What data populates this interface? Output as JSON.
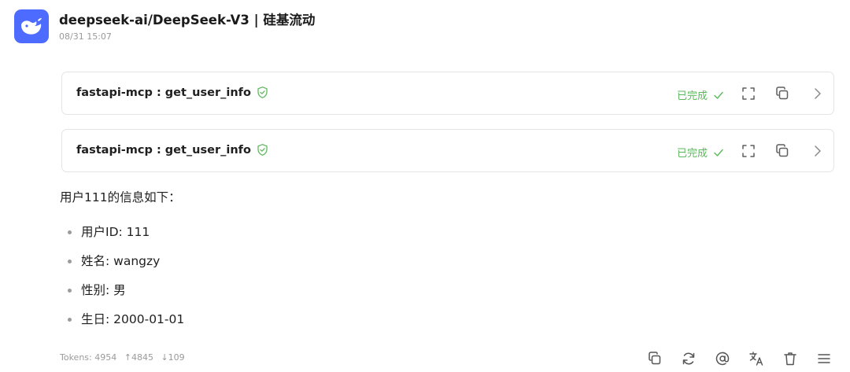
{
  "header": {
    "title": "deepseek-ai/DeepSeek-V3 | 硅基流动",
    "timestamp": "08/31 15:07"
  },
  "tool_calls": [
    {
      "name": "fastapi-mcp : get_user_info",
      "status": "已完成"
    },
    {
      "name": "fastapi-mcp : get_user_info",
      "status": "已完成"
    }
  ],
  "message": {
    "intro": "用户111的信息如下：",
    "items": [
      "用户ID: 111",
      "姓名: wangzy",
      "性别: 男",
      "生日: 2000-01-01"
    ]
  },
  "footer": {
    "tokens_label": "Tokens: 4954",
    "tokens_up": "↑4845",
    "tokens_down": "↓109"
  },
  "icons": {
    "avatar": "deepseek-whale-icon",
    "tool_verified": "shield-check-icon",
    "status_done": "check-icon",
    "expand": "fullscreen-icon",
    "copy": "copy-icon",
    "open": "chevron-right-icon",
    "actions": [
      "copy-icon",
      "refresh-icon",
      "at-icon",
      "translate-icon",
      "trash-icon",
      "menu-icon"
    ]
  },
  "colors": {
    "brand": "#4d6bfe",
    "success": "#5cb85c",
    "muted_text": "#9a9a9a",
    "border": "#e4e4e7"
  }
}
